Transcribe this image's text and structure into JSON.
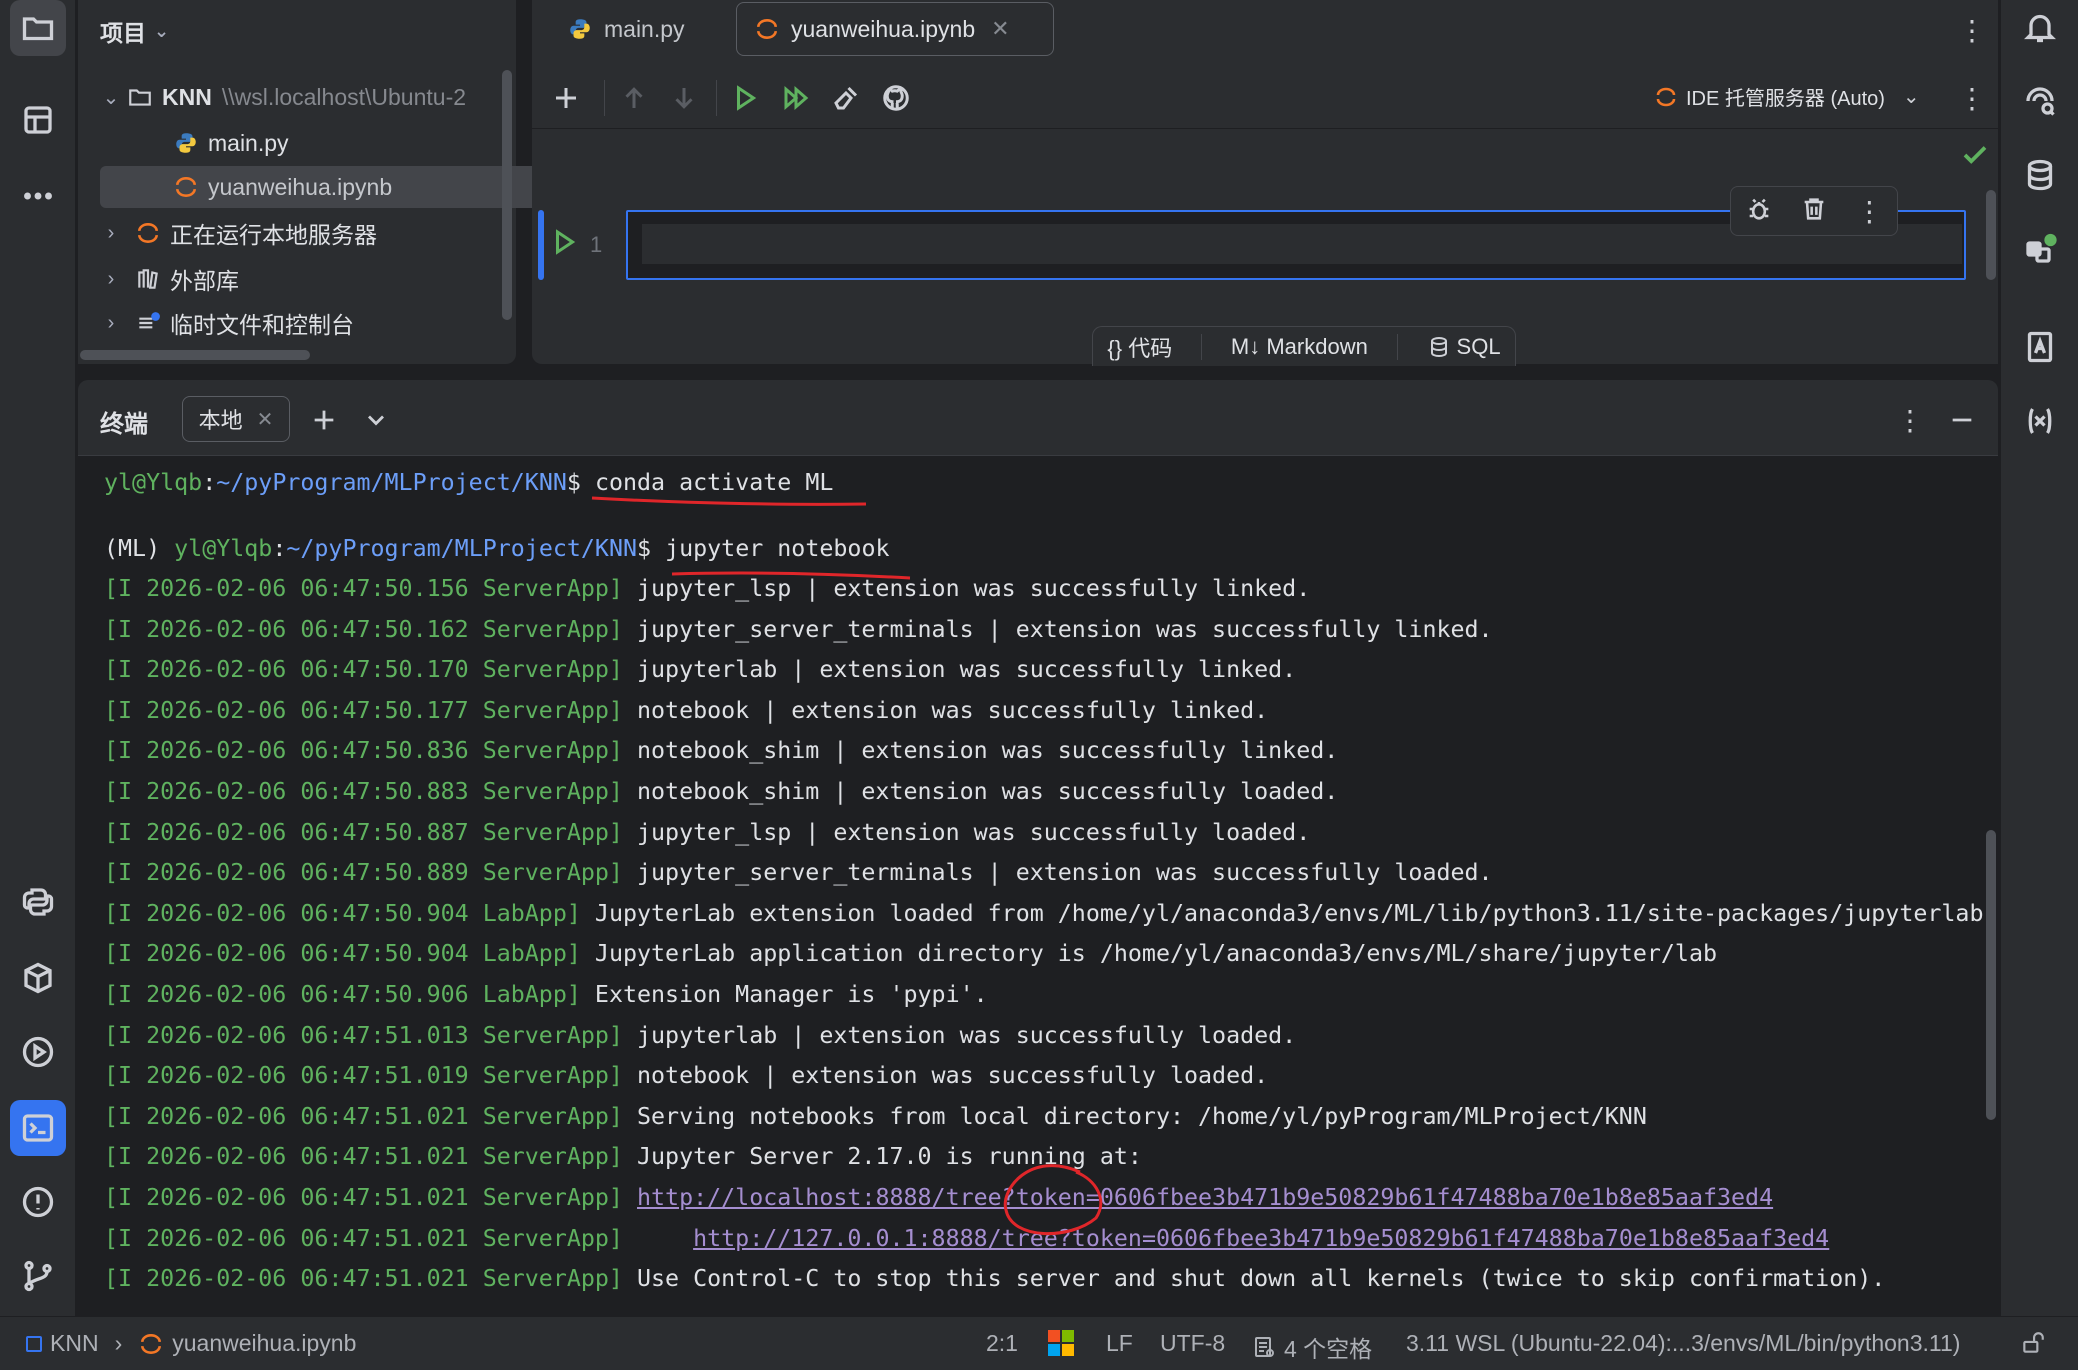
{
  "project_panel": {
    "title": "项目",
    "root": {
      "name": "KNN",
      "path": "\\\\wsl.localhost\\Ubuntu-2"
    },
    "files": [
      "main.py",
      "yuanweihua.ipynb"
    ],
    "nodes": [
      "正在运行本地服务器",
      "外部库",
      "临时文件和控制台"
    ]
  },
  "editor": {
    "tabs": [
      {
        "label": "main.py",
        "icon": "python-file-icon"
      },
      {
        "label": "yuanweihua.ipynb",
        "icon": "jupyter-notebook-icon",
        "active": true
      }
    ],
    "server_label": "IDE 托管服务器 (Auto)",
    "cell_number": "1",
    "add_cell": {
      "code": "{} 代码",
      "markdown": "M↓ Markdown",
      "sql": "SQL"
    }
  },
  "terminal": {
    "title": "终端",
    "tab_label": "本地",
    "prompt1": {
      "user": "yl@Ylqb",
      "sep": ":",
      "path": "~/pyProgram/MLProject/KNN",
      "sign": "$ ",
      "cmd": "conda activate ML"
    },
    "prompt2": {
      "env": "(ML) ",
      "user": "yl@Ylqb",
      "sep": ":",
      "path": "~/pyProgram/MLProject/KNN",
      "sign": "$ ",
      "cmd": "jupyter notebook"
    },
    "logs": [
      {
        "prefix": "[I 2026-02-06 06:47:50.156 ServerApp]",
        "msg": " jupyter_lsp | extension was successfully linked."
      },
      {
        "prefix": "[I 2026-02-06 06:47:50.162 ServerApp]",
        "msg": " jupyter_server_terminals | extension was successfully linked."
      },
      {
        "prefix": "[I 2026-02-06 06:47:50.170 ServerApp]",
        "msg": " jupyterlab | extension was successfully linked."
      },
      {
        "prefix": "[I 2026-02-06 06:47:50.177 ServerApp]",
        "msg": " notebook | extension was successfully linked."
      },
      {
        "prefix": "[I 2026-02-06 06:47:50.836 ServerApp]",
        "msg": " notebook_shim | extension was successfully linked."
      },
      {
        "prefix": "[I 2026-02-06 06:47:50.883 ServerApp]",
        "msg": " notebook_shim | extension was successfully loaded."
      },
      {
        "prefix": "[I 2026-02-06 06:47:50.887 ServerApp]",
        "msg": " jupyter_lsp | extension was successfully loaded."
      },
      {
        "prefix": "[I 2026-02-06 06:47:50.889 ServerApp]",
        "msg": " jupyter_server_terminals | extension was successfully loaded."
      },
      {
        "prefix": "[I 2026-02-06 06:47:50.904 LabApp]",
        "msg": " JupyterLab extension loaded from /home/yl/anaconda3/envs/ML/lib/python3.11/site-packages/jupyterlab"
      },
      {
        "prefix": "[I 2026-02-06 06:47:50.904 LabApp]",
        "msg": " JupyterLab application directory is /home/yl/anaconda3/envs/ML/share/jupyter/lab"
      },
      {
        "prefix": "[I 2026-02-06 06:47:50.906 LabApp]",
        "msg": " Extension Manager is 'pypi'."
      },
      {
        "prefix": "[I 2026-02-06 06:47:51.013 ServerApp]",
        "msg": " jupyterlab | extension was successfully loaded."
      },
      {
        "prefix": "[I 2026-02-06 06:47:51.019 ServerApp]",
        "msg": " notebook | extension was successfully loaded."
      },
      {
        "prefix": "[I 2026-02-06 06:47:51.021 ServerApp]",
        "msg": " Serving notebooks from local directory: /home/yl/pyProgram/MLProject/KNN"
      },
      {
        "prefix": "[I 2026-02-06 06:47:51.021 ServerApp]",
        "msg": " Jupyter Server 2.17.0 is running at:"
      },
      {
        "prefix": "[I 2026-02-06 06:47:51.021 ServerApp]",
        "msg": " ",
        "link": "http://localhost:8888/tree?token=0606fbee3b471b9e50829b61f47488ba70e1b8e85aaf3ed4"
      },
      {
        "prefix": "[I 2026-02-06 06:47:51.021 ServerApp]",
        "msg": "     ",
        "link": "http://127.0.0.1:8888/tree?token=0606fbee3b471b9e50829b61f47488ba70e1b8e85aaf3ed4"
      },
      {
        "prefix": "[I 2026-02-06 06:47:51.021 ServerApp]",
        "msg": " Use Control-C to stop this server and shut down all kernels (twice to skip confirmation)."
      }
    ]
  },
  "status_bar": {
    "project": "KNN",
    "file": "yuanweihua.ipynb",
    "position": "2:1",
    "line_sep": "LF",
    "encoding": "UTF-8",
    "indent": "4 个空格",
    "interpreter": "3.11 WSL (Ubuntu-22.04):...3/envs/ML/bin/python3.11)"
  },
  "colors": {
    "accent": "#3574f0",
    "prompt_user": "#5fb25f",
    "prompt_path": "#6c9ef8",
    "link": "#a58ed0",
    "annotation": "#e0262a"
  }
}
